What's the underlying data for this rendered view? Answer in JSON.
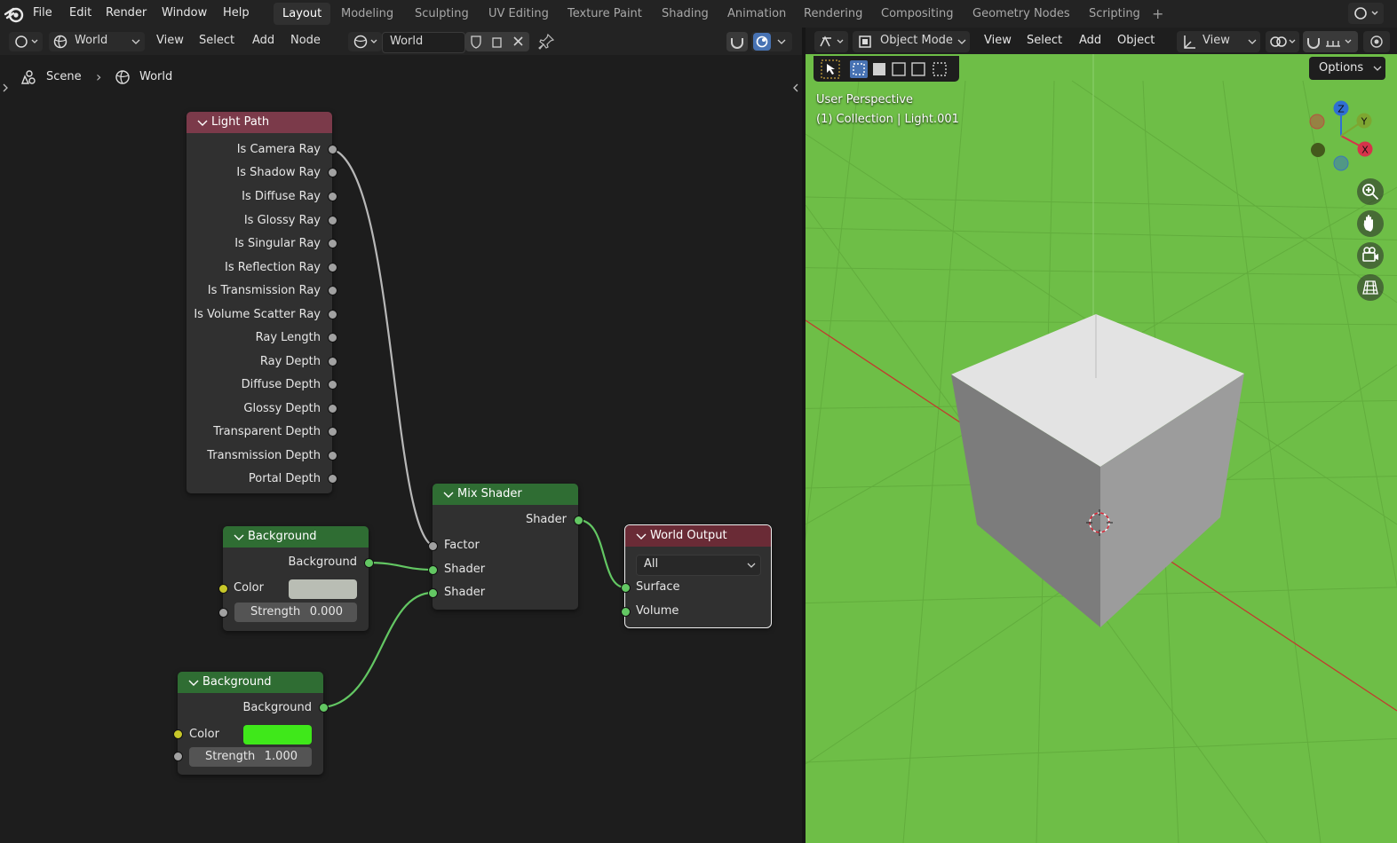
{
  "topbar": {
    "menus": [
      "File",
      "Edit",
      "Render",
      "Window",
      "Help"
    ],
    "workspaces": [
      "Layout",
      "Modeling",
      "Sculpting",
      "UV Editing",
      "Texture Paint",
      "Shading",
      "Animation",
      "Rendering",
      "Compositing",
      "Geometry Nodes",
      "Scripting"
    ],
    "active_workspace": "Layout",
    "add_workspace": "+"
  },
  "node_editor": {
    "header": {
      "shader_type": "World",
      "menus": [
        "View",
        "Select",
        "Add",
        "Node"
      ],
      "world_name": "World"
    },
    "breadcrumb": {
      "scene": "Scene",
      "separator": "›",
      "world": "World"
    },
    "nodes": {
      "light_path": {
        "title": "Light Path",
        "outputs": [
          "Is Camera Ray",
          "Is Shadow Ray",
          "Is Diffuse Ray",
          "Is Glossy Ray",
          "Is Singular Ray",
          "Is Reflection Ray",
          "Is Transmission Ray",
          "Is Volume Scatter Ray",
          "Ray Length",
          "Ray Depth",
          "Diffuse Depth",
          "Glossy Depth",
          "Transparent Depth",
          "Transmission Depth",
          "Portal Depth"
        ]
      },
      "background_1": {
        "title": "Background",
        "output": "Background",
        "color_label": "Color",
        "color": "#b9bdb4",
        "strength_label": "Strength",
        "strength": "0.000"
      },
      "background_2": {
        "title": "Background",
        "output": "Background",
        "color_label": "Color",
        "color": "#3fe81a",
        "strength_label": "Strength",
        "strength": "1.000"
      },
      "mix_shader": {
        "title": "Mix Shader",
        "output": "Shader",
        "inputs": [
          "Factor",
          "Shader",
          "Shader"
        ]
      },
      "world_output": {
        "title": "World Output",
        "target": "All",
        "inputs": [
          "Surface",
          "Volume"
        ]
      }
    }
  },
  "viewport": {
    "header": {
      "mode": "Object Mode",
      "menus": [
        "View",
        "Select",
        "Add",
        "Object"
      ],
      "orientation": "View"
    },
    "options_label": "Options",
    "perspective_label": "User Perspective",
    "collection_label": "(1) Collection | Light.001",
    "gizmo": {
      "x": "X",
      "y": "Y",
      "z": "Z"
    },
    "background_color": "#6ebe47"
  },
  "colors": {
    "accent": "#4772b3",
    "link_green": "#63c763",
    "link_grey": "#a1a1a1",
    "node_input_header": "#7b3a4a",
    "node_shader_header": "#2f6d33",
    "node_output_header": "#6a2b36"
  }
}
